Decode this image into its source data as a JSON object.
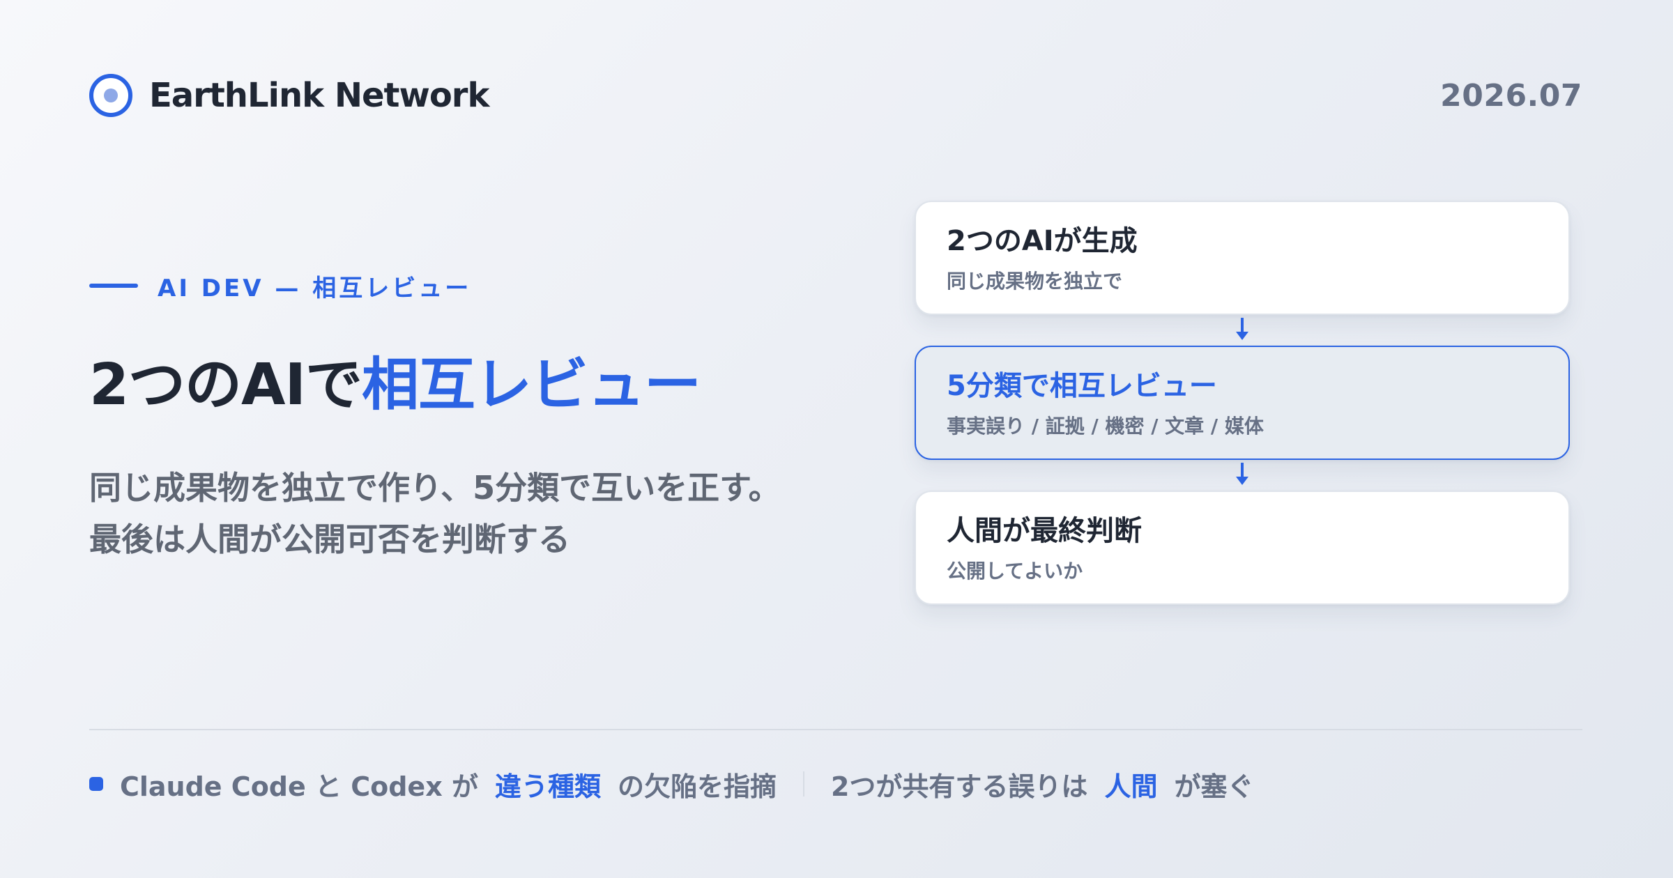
{
  "header": {
    "brand_name": "EarthLink Network",
    "date": "2026.07"
  },
  "hero": {
    "eyebrow": "AI DEV — 相互レビュー",
    "title_prefix": "2つのAIで",
    "title_highlight": "相互レビュー",
    "description_lines": [
      "同じ成果物を独立で作り、5分類で互いを正す。",
      "最後は人間が公開可否を判断する"
    ]
  },
  "flow": {
    "steps": [
      {
        "title": "2つのAIが生成",
        "subtitle": "同じ成果物を独立で"
      },
      {
        "title": "5分類で相互レビュー",
        "subtitle": "事実誤り / 証拠 / 機密 / 文章 / 媒体"
      },
      {
        "title": "人間が最終判断",
        "subtitle": "公開してよいか"
      }
    ]
  },
  "footer": {
    "text_1": "Claude Code と Codex が",
    "highlight_1": "違う種類",
    "text_2": "の欠陥を指摘",
    "text_3": "2つが共有する誤りは",
    "highlight_2": "人間",
    "text_4": "が塞ぐ"
  },
  "colors": {
    "accent": "#2b63e3",
    "text_dark": "#1f2633",
    "text_muted": "#667085",
    "card_background": "#ffffff",
    "active_card_background": "#e7ecf2"
  },
  "icons": {
    "logo": "circle-logo-icon",
    "flow_arrow": "arrow-down-icon",
    "footer_marker": "square-dot-icon"
  }
}
